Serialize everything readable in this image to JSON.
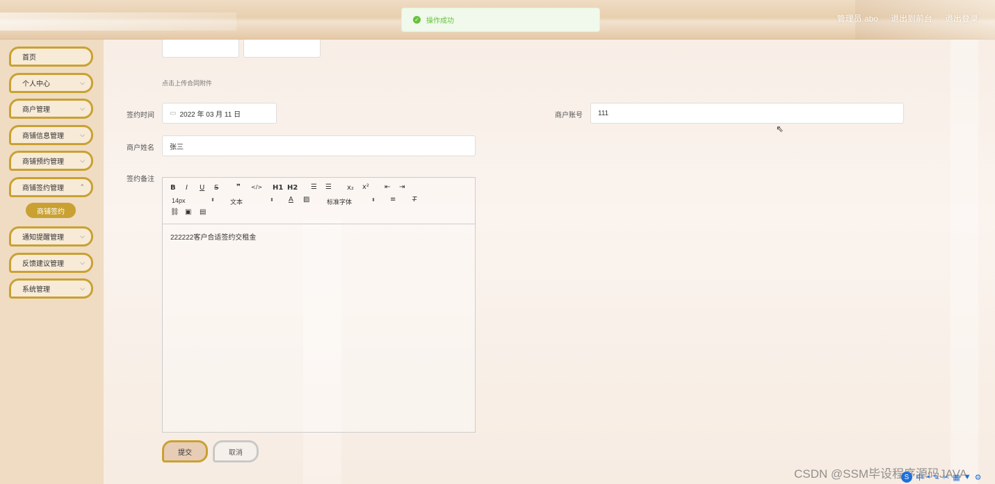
{
  "header": {
    "user_label": "管理员 abo",
    "back_front": "退出到前台",
    "logout": "退出登录"
  },
  "toast": {
    "message": "操作成功"
  },
  "sidebar": {
    "items": [
      {
        "label": "首页"
      },
      {
        "label": "个人中心"
      },
      {
        "label": "商户管理"
      },
      {
        "label": "商铺信息管理"
      },
      {
        "label": "商铺预约管理"
      },
      {
        "label": "商铺签约管理"
      },
      {
        "label": "通知提醒管理"
      },
      {
        "label": "反馈建议管理"
      },
      {
        "label": "系统管理"
      }
    ],
    "active_sub": "商铺签约"
  },
  "form": {
    "upload_hint": "点击上传合同附件",
    "sign_time_label": "签约时间",
    "sign_time_value": "2022 年 03 月 11 日",
    "account_label": "商户账号",
    "account_value": "111",
    "name_label": "商户姓名",
    "name_value": "张三",
    "remark_label": "签约备注",
    "remark_content": "222222客户合适签约交租金",
    "submit": "提交",
    "cancel": "取消"
  },
  "editor": {
    "font_size": "14px",
    "text_style": "文本",
    "font_family": "标准字体",
    "h1": "H1",
    "h2": "H2"
  },
  "watermark": "CSDN @SSM毕设程序源码JAVA",
  "colors": {
    "accent": "#c9a133",
    "success": "#67c23a",
    "sidebar_bg": "#efdcc2"
  }
}
